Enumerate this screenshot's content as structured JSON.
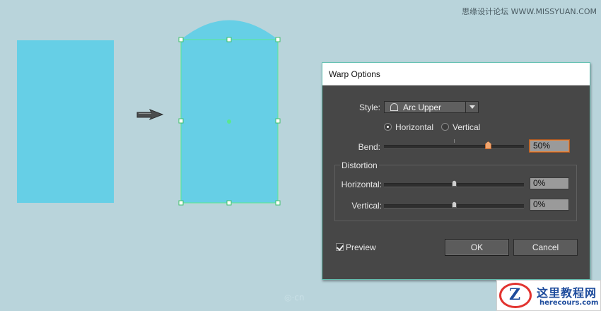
{
  "watermarks": {
    "top_right": "思缘设计论坛 WWW.MISSYUAN.COM",
    "bottom_center": "·cn"
  },
  "logo": {
    "mark_letter": "Z",
    "name": "这里教程网",
    "url": "herecours.com"
  },
  "dialog": {
    "title": "Warp Options",
    "style_label": "Style:",
    "style_value": "Arc Upper",
    "orientation": {
      "horizontal_label": "Horizontal",
      "vertical_label": "Vertical",
      "selected": "Horizontal"
    },
    "bend": {
      "label": "Bend:",
      "value": "50%",
      "level_percent": 50
    },
    "distortion": {
      "legend": "Distortion",
      "horizontal_label": "Horizontal:",
      "horizontal_value": "0%",
      "vertical_label": "Vertical:",
      "vertical_value": "0%"
    },
    "preview_label": "Preview",
    "preview_checked": true,
    "ok_label": "OK",
    "cancel_label": "Cancel"
  },
  "colors": {
    "canvas_background": "#b9d4db",
    "shape_fill": "#66cfe6",
    "selection": "#5ae88e",
    "dialog_bg": "#474747"
  }
}
